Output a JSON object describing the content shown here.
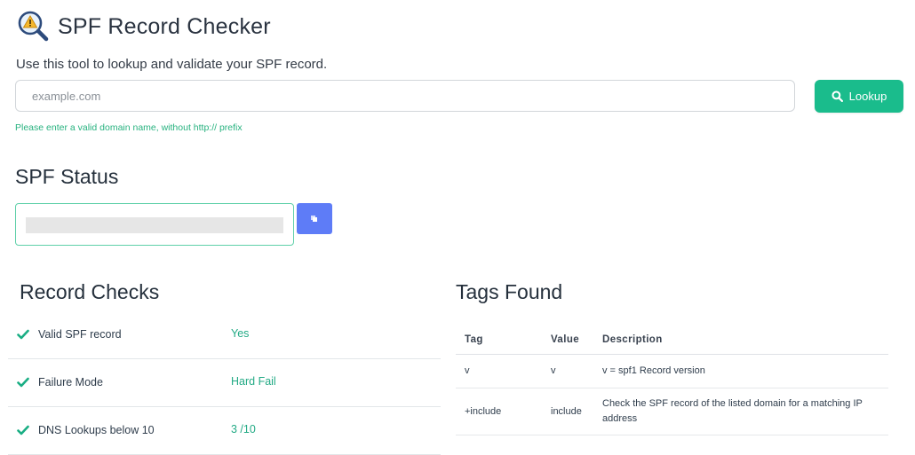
{
  "header": {
    "title": "SPF Record Checker",
    "logo_icon": "magnifier-warning-icon"
  },
  "subtitle": "Use this tool to lookup and validate your SPF record.",
  "search": {
    "placeholder": "example.com",
    "value": "",
    "button_label": "Lookup",
    "button_icon": "search-icon",
    "hint": "Please enter a valid domain name, without http:// prefix"
  },
  "status": {
    "heading": "SPF Status",
    "copy_icon": "copy-icon"
  },
  "record_checks": {
    "heading": "Record Checks",
    "items": [
      {
        "label": "Valid SPF record",
        "value": "Yes"
      },
      {
        "label": "Failure Mode",
        "value": "Hard Fail"
      },
      {
        "label": "DNS Lookups below 10",
        "value": "3 /10"
      }
    ]
  },
  "tags_found": {
    "heading": "Tags Found",
    "columns": [
      "Tag",
      "Value",
      "Description"
    ],
    "rows": [
      {
        "tag": "v",
        "value": "v",
        "description": "v = spf1 Record version"
      },
      {
        "tag": "+include",
        "value": "include",
        "description": "Check the SPF record of the listed domain for a matching IP address"
      }
    ]
  },
  "colors": {
    "accent": "#1abc8c",
    "copy_button": "#5e7cf7",
    "hint": "#27b27f"
  }
}
